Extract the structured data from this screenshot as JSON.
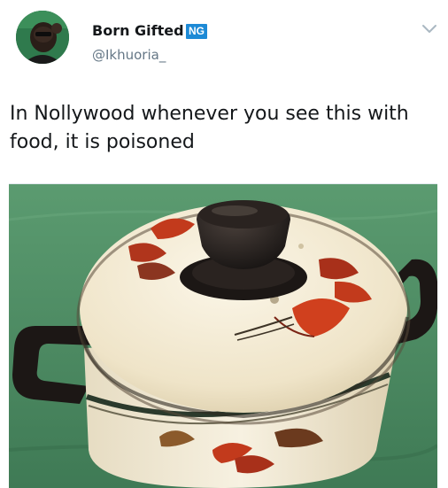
{
  "tweet": {
    "author_name": "Born Gifted",
    "country_badge": "NG",
    "handle": "@Ikhuoria_",
    "text": "In Nollywood whenever you see this with food, it is poisoned",
    "avatar_icon": "profile-photo",
    "menu_icon": "chevron-down-icon"
  },
  "media": {
    "subject": "enamel cooking pot with lid and black handles",
    "colors": {
      "background": "#4d8b62",
      "pot_enamel": "#f4ecd7",
      "handles": "#1c1715",
      "leaf_red": "#c23a1c"
    }
  },
  "colors": {
    "badge": "#1d8ad6",
    "handle_text": "#657786",
    "text": "#14171a"
  }
}
